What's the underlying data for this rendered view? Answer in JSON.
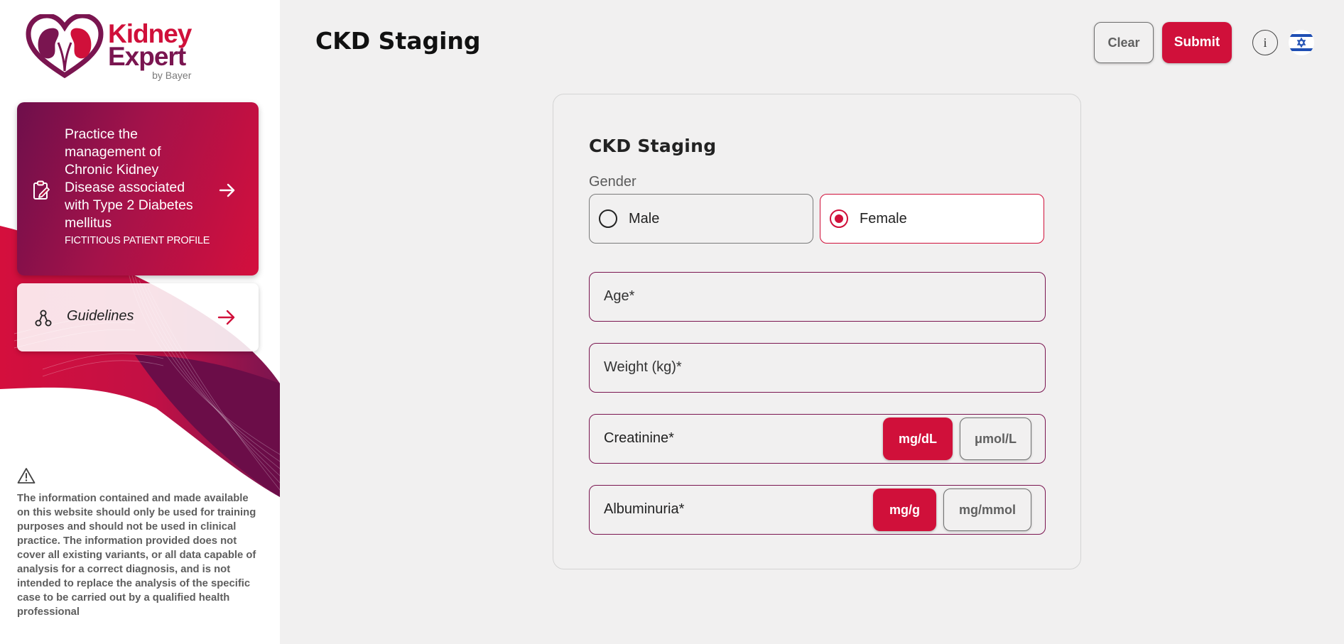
{
  "brand": {
    "line1": "Kidney",
    "line2": "Expert",
    "line3": "by Bayer",
    "primary_color": "#d0103a",
    "secondary_color": "#7a1550"
  },
  "sidebar": {
    "practice_card": {
      "title": "Practice the management of Chronic Kidney Disease associated with Type 2 Diabetes mellitus",
      "subtitle": "FICTITIOUS PATIENT PROFILE",
      "icon": "clipboard-pen-icon"
    },
    "guidelines_card": {
      "label": "Guidelines",
      "icon": "network-icon"
    },
    "disclaimer": "The information contained and made available on this website should only be used for training purposes and should not be used in clinical practice. The information provided does not cover all existing variants, or all data capable of analysis for a correct diagnosis, and is not intended to replace the analysis of the specific case to be carried out by a qualified health professional"
  },
  "header": {
    "title": "CKD Staging",
    "clear_label": "Clear",
    "submit_label": "Submit",
    "info_label": "i",
    "language_flag": "israel-flag-icon"
  },
  "form": {
    "title": "CKD Staging",
    "gender_label": "Gender",
    "gender_options": [
      {
        "label": "Male",
        "selected": false
      },
      {
        "label": "Female",
        "selected": true
      }
    ],
    "age_placeholder": "Age*",
    "weight_placeholder": "Weight (kg)*",
    "creatinine": {
      "label": "Creatinine*",
      "units": [
        {
          "label": "mg/dL",
          "active": true
        },
        {
          "label": "μmol/L",
          "active": false
        }
      ]
    },
    "albuminuria": {
      "label": "Albuminuria*",
      "units": [
        {
          "label": "mg/g",
          "active": true
        },
        {
          "label": "mg/mmol",
          "active": false
        }
      ]
    }
  }
}
